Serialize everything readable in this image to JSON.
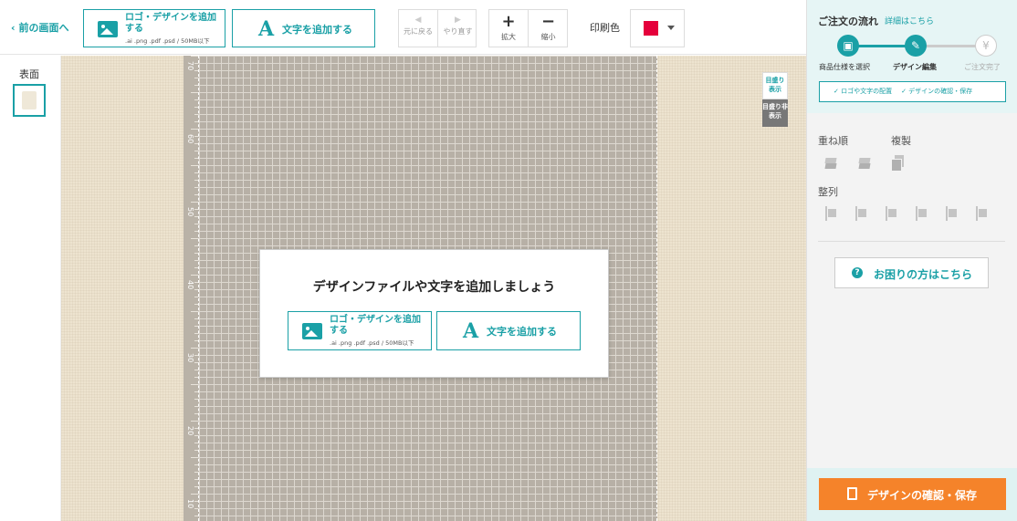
{
  "toolbar": {
    "back_label": "前の画面へ",
    "upload_label": "ロゴ・デザインを追加する",
    "upload_sub": ".ai .png .pdf .psd / 50MB以下",
    "add_text_label": "文字を追加する",
    "undo_label": "元に戻る",
    "redo_label": "やり直す",
    "zoom_in_label": "拡大",
    "zoom_out_label": "縮小",
    "print_color_label": "印刷色",
    "print_color": "#e5003b"
  },
  "left": {
    "face_label": "表面"
  },
  "canvas": {
    "ruler_ticks": [
      "70",
      "60",
      "50",
      "40",
      "30",
      "20",
      "10"
    ],
    "grid_on_label": "目盛り表示",
    "grid_off_label": "目盛り非表示"
  },
  "modal": {
    "title": "デザインファイルや文字を追加しましょう",
    "upload_label": "ロゴ・デザインを追加する",
    "upload_sub": ".ai .png .pdf .psd / 50MB以下",
    "add_text_label": "文字を追加する"
  },
  "sidebar": {
    "flow_title": "ご注文の流れ",
    "flow_link": "詳細はこちら",
    "step1": "商品仕様を選択",
    "step2": "デザイン編集",
    "step3": "ご注文完了",
    "sub1": "✓ ロゴや文字の配置",
    "sub2": "✓ デザインの確認・保存",
    "layer_label": "重ね順",
    "copy_label": "複製",
    "align_label": "整列",
    "help_label": "お困りの方はこちら",
    "save_label": "デザインの確認・保存"
  }
}
